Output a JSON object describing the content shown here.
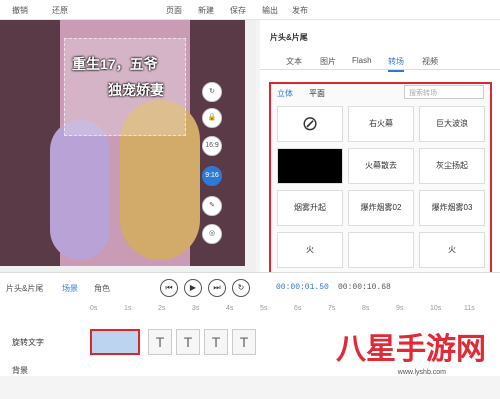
{
  "topbar": {
    "undo": "撤销",
    "redo": "还原",
    "page": "页面",
    "new": "新建",
    "save": "保存",
    "export": "输出",
    "publish": "发布"
  },
  "canvas": {
    "caption_line1": "重生17，五爷",
    "caption_line2": "独宠娇妻",
    "controls": [
      "↻",
      "🔒",
      "16:9",
      "9:16",
      "✎",
      "◎"
    ]
  },
  "panel": {
    "title": "片头&片尾",
    "tabs": [
      "文本",
      "图片",
      "Flash",
      "转场",
      "视频"
    ],
    "subtabs": [
      "立体",
      "平面"
    ],
    "search_placeholder": "搜索转场",
    "transitions": [
      "",
      "右火幕",
      "巨大波浪",
      "",
      "火幕散去",
      "灰尘扬起",
      "烟雾升起",
      "爆炸烟雾02",
      "爆炸烟雾03",
      "火",
      "",
      "火"
    ]
  },
  "timeline": {
    "headers": [
      "片头&片尾",
      "场景",
      "角色"
    ],
    "current_time": "00:00:01.50",
    "total_time": "00:00:10.68",
    "ruler": [
      "0s",
      "1s",
      "2s",
      "3s",
      "4s",
      "5s",
      "6s",
      "7s",
      "8s",
      "9s",
      "10s",
      "11s"
    ],
    "tracks": [
      "旋转文字",
      "背景"
    ],
    "clip_label": "T"
  },
  "watermark": {
    "logo": "八星手游网",
    "url": "www.lyshb.com"
  }
}
